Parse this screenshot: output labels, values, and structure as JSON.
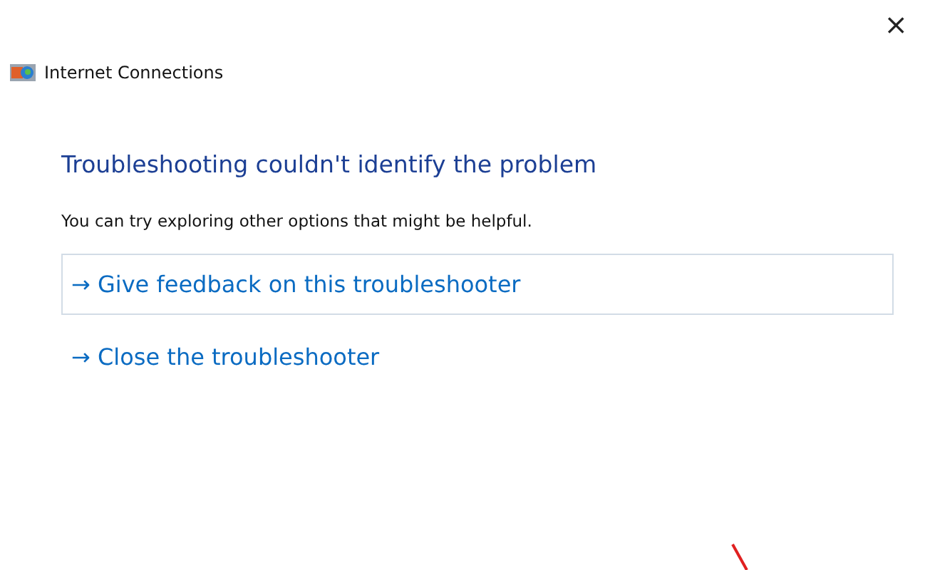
{
  "window": {
    "close": "×",
    "app_title": "Internet Connections"
  },
  "heading": "Troubleshooting couldn't identify the problem",
  "message": "You can try exploring other options that might be helpful.",
  "links": [
    {
      "arrow": "→",
      "label": "Give feedback on this troubleshooter",
      "selected": true
    },
    {
      "arrow": "→",
      "label": "Close the troubleshooter",
      "selected": false
    }
  ]
}
